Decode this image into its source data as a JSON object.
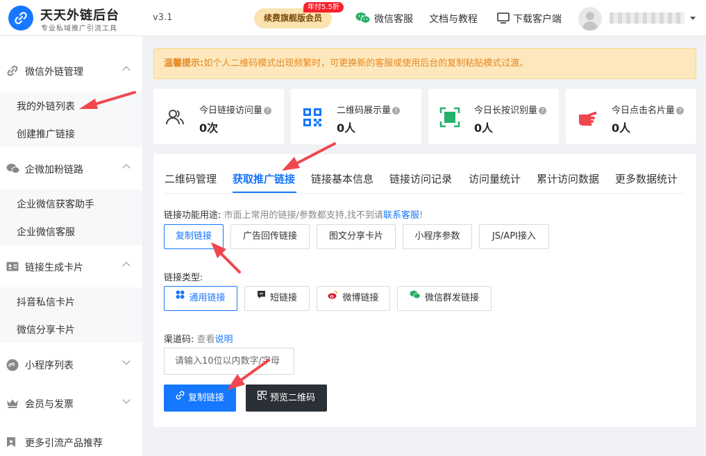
{
  "header": {
    "logo_title": "天天外链后台",
    "logo_subtitle": "专业私域推广引流工具",
    "version": "v3.1",
    "vip_button": "续费旗舰版会员",
    "vip_badge": "年付5.5折",
    "nav": {
      "wechat_service": "微信客服",
      "docs": "文档与教程",
      "download": "下载客户端"
    }
  },
  "sidebar": {
    "groups": [
      {
        "label": "微信外链管理",
        "icon": "link-icon",
        "expanded": true,
        "items": [
          "我的外链列表",
          "创建推广链接"
        ]
      },
      {
        "label": "企微加粉链路",
        "icon": "chat-bubbles-icon",
        "expanded": true,
        "items": [
          "企业微信获客助手",
          "企业微信客服"
        ]
      },
      {
        "label": "链接生成卡片",
        "icon": "id-card-icon",
        "expanded": true,
        "items": [
          "抖音私信卡片",
          "微信分享卡片"
        ]
      },
      {
        "label": "小程序列表",
        "icon": "mini-program-icon",
        "expanded": false,
        "items": []
      },
      {
        "label": "会员与发票",
        "icon": "crown-icon",
        "expanded": false,
        "items": []
      },
      {
        "label": "更多引流产品推荐",
        "icon": "bookmark-icon",
        "expanded": false,
        "items": []
      }
    ]
  },
  "notice": {
    "prefix": "温馨提示:",
    "text": "如个人二维码模式出现频繁时，可更换新的客服或使用后台的复制粘贴模式过渡。"
  },
  "stats": [
    {
      "label": "今日链接访问量",
      "value": "0次",
      "icon": "users-icon"
    },
    {
      "label": "二维码展示量",
      "value": "0人",
      "icon": "qrcode-icon"
    },
    {
      "label": "今日长按识别量",
      "value": "0人",
      "icon": "scan-icon"
    },
    {
      "label": "今日点击名片量",
      "value": "0人",
      "icon": "pointing-hand-icon"
    }
  ],
  "tabs": [
    "二维码管理",
    "获取推广链接",
    "链接基本信息",
    "链接访问记录",
    "访问量统计",
    "累计访问数据",
    "更多数据统计"
  ],
  "active_tab": "获取推广链接",
  "usage": {
    "label": "链接功能用途:",
    "hint": "市面上常用的链接/参数都支持,找不到请",
    "link": "联系客服",
    "tail": "!",
    "options": [
      "复制链接",
      "广告回传链接",
      "图文分享卡片",
      "小程序参数",
      "JS/API接入"
    ],
    "selected": "复制链接"
  },
  "link_type": {
    "label": "链接类型:",
    "options": [
      "通用链接",
      "短链接",
      "微博链接",
      "微信群发链接"
    ],
    "selected": "通用链接"
  },
  "channel": {
    "label": "渠道码:",
    "hint": "查看",
    "link": "说明",
    "placeholder": "请输入10位以内数字/字母"
  },
  "actions": {
    "copy_link": "复制链接",
    "preview_qr": "预览二维码"
  },
  "colors": {
    "primary": "#1677ff",
    "notice_bg": "#fde8bd",
    "notice_text": "#e8871e",
    "annotation_arrow": "#f0474e",
    "dark_button": "#2b2f36"
  }
}
